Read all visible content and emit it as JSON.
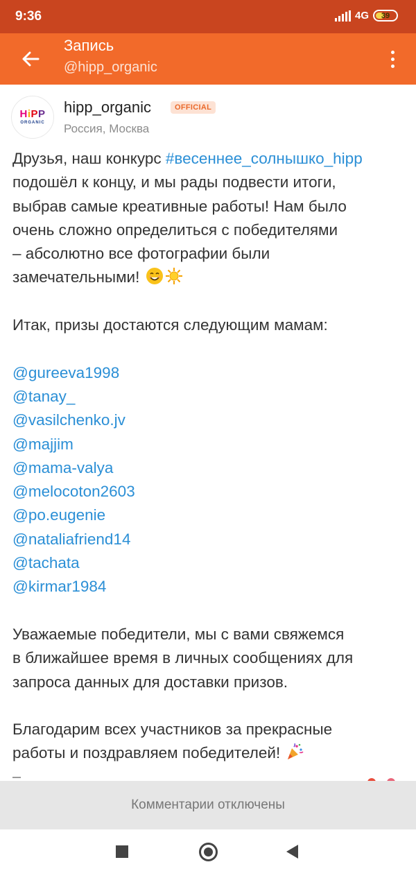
{
  "status_bar": {
    "time": "9:36",
    "network": "4G",
    "battery": "39"
  },
  "app_bar": {
    "title": "Запись",
    "subtitle": "@hipp_organic",
    "back_icon": "arrow-left-icon",
    "more_icon": "more-vertical-icon"
  },
  "post": {
    "author": {
      "logo_text": "HiPP",
      "logo_sub": "ORGANIC",
      "name": "hipp_organic",
      "badge": "OFFICIAL",
      "location": "Россия, Москва"
    },
    "intro_lines": [
      {
        "prefix": "Друзья, наш конкурс ",
        "hashtag": "#весеннее_солнышко_hipp"
      },
      {
        "text": "подошёл к концу, и мы рады подвести итоги,"
      },
      {
        "text": "выбрав самые креативные работы! Нам было"
      },
      {
        "text": "очень сложно определиться с победителями"
      },
      {
        "text": "– абсолютно все фотографии были"
      },
      {
        "text": "замечательными!"
      }
    ],
    "intro_emojis": [
      "smiling-face-emoji",
      "sun-emoji"
    ],
    "prizes_line": "Итак, призы достаются следующим мамам:",
    "winners": [
      "@gureeva1998",
      "@tanay_",
      "@vasilchenko.jv",
      "@majjim",
      "@mama-valya",
      "@melocoton2603",
      "@po.eugenie",
      "@nataliafriend14",
      "@tachata",
      "@kirmar1984"
    ],
    "contact_lines": [
      "Уважаемые победители, мы с вами свяжемся",
      "в ближайшее время в личных сообщениях для",
      "запроса данных для доставки призов."
    ],
    "thanks_lines": [
      "Благодарим всех участников за прекрасные",
      "работы и поздравляем победителей!"
    ],
    "thanks_emoji": "party-popper-emoji"
  },
  "comments_disabled": "Комментарии отключены",
  "nav": {
    "recents_icon": "square-recents-icon",
    "home_icon": "circle-home-icon",
    "back_icon": "triangle-back-icon"
  },
  "colors": {
    "status_bar": "#c9451f",
    "app_bar": "#f26a2a",
    "link": "#2b8fd6",
    "badge_bg": "#fde2d4",
    "badge_text": "#ea6a2c",
    "comments_bar": "#e6e6e6"
  }
}
